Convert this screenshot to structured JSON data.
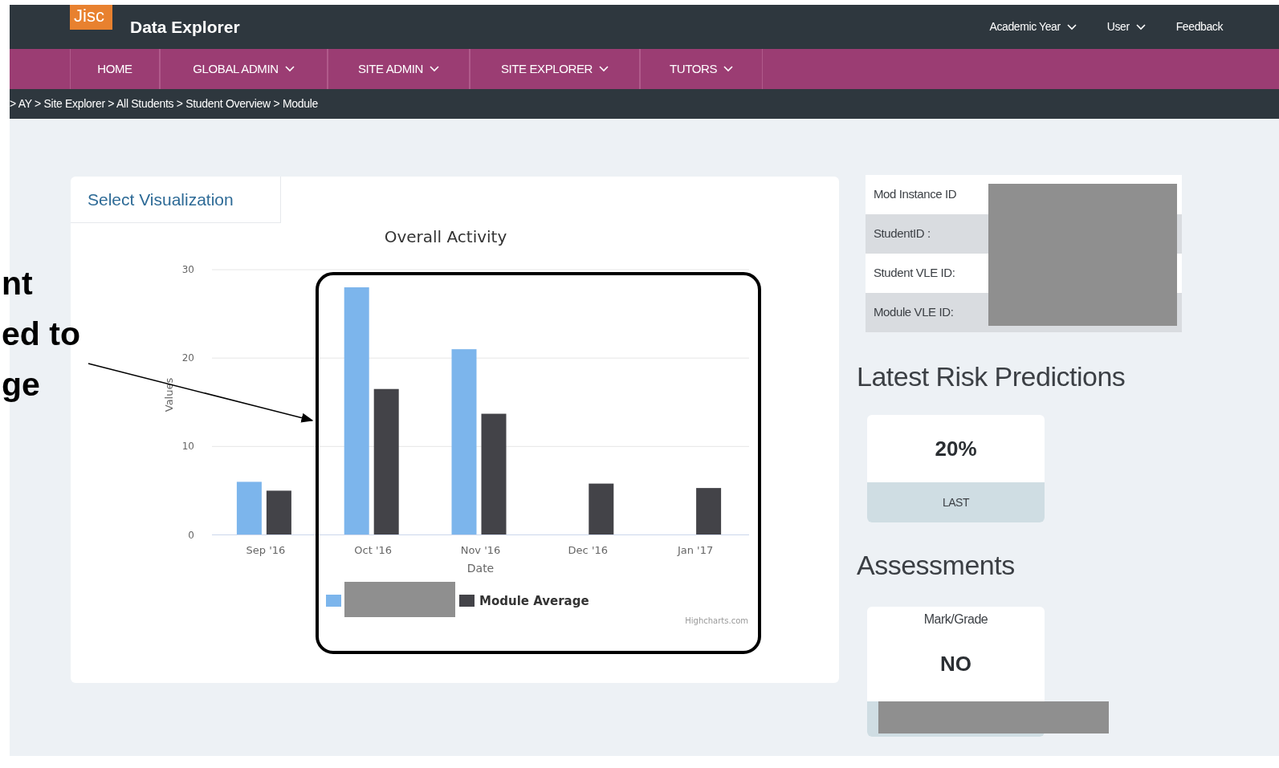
{
  "header": {
    "logo": "Jisc",
    "title": "Data Explorer",
    "menu": [
      {
        "label": "Academic Year",
        "dropdown": true
      },
      {
        "label": "User",
        "dropdown": true
      },
      {
        "label": "Feedback",
        "dropdown": false
      }
    ]
  },
  "nav": [
    {
      "label": "HOME",
      "dropdown": false
    },
    {
      "label": "GLOBAL ADMIN",
      "dropdown": true
    },
    {
      "label": "SITE ADMIN",
      "dropdown": true
    },
    {
      "label": "SITE EXPLORER",
      "dropdown": true
    },
    {
      "label": "TUTORS",
      "dropdown": true
    }
  ],
  "breadcrumb": "> AY > Site Explorer > All Students > Student Overview > Module",
  "visualization": {
    "tab": "Select Visualization",
    "credit": "Highcharts.com",
    "chart_data": {
      "type": "bar",
      "title": "Overall Activity",
      "xlabel": "Date",
      "ylabel": "Values",
      "categories": [
        "Sep '16",
        "Oct '16",
        "Nov '16",
        "Dec '16",
        "Jan '17"
      ],
      "ylim": [
        0,
        30
      ],
      "yticks": [
        0,
        10,
        20,
        30
      ],
      "series": [
        {
          "color": "#7cb5ec",
          "values": [
            6,
            28,
            21,
            null,
            null
          ]
        },
        {
          "name": "Module Average",
          "color": "#434348",
          "values": [
            5,
            16.5,
            13.7,
            5.8,
            5.3
          ]
        }
      ]
    }
  },
  "details": [
    {
      "label": "Mod Instance ID"
    },
    {
      "label": "StudentID :"
    },
    {
      "label": "Student VLE ID:"
    },
    {
      "label": "Module VLE ID:"
    }
  ],
  "risk": {
    "heading": "Latest Risk Predictions",
    "value": "20%",
    "caption": "LAST"
  },
  "assessments": {
    "heading": "Assessments",
    "label": "Mark/Grade",
    "value": "NO"
  },
  "annotation": {
    "lines": [
      "nt",
      "ed to",
      "ge"
    ]
  }
}
